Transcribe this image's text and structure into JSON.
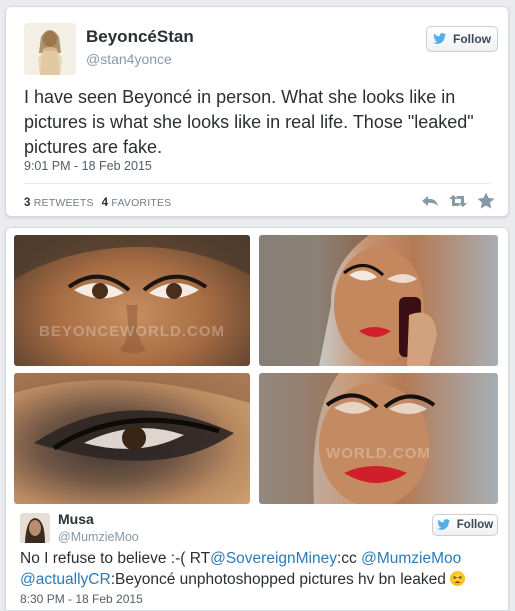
{
  "tweet1": {
    "display_name": "BeyoncéStan",
    "handle": "@stan4yonce",
    "follow_label": "Follow",
    "text": "I have seen Beyoncé in person. What she looks like in pictures is what she looks like in real life. Those \"leaked\" pictures are fake.",
    "timestamp": "9:01 PM - 18 Feb 2015",
    "retweets_count": "3",
    "retweets_label": "RETWEETS",
    "favorites_count": "4",
    "favorites_label": "FAVORITES",
    "icons": [
      "reply-icon",
      "retweet-icon",
      "favorite-icon",
      "twitter-bird-icon"
    ]
  },
  "tweet2": {
    "photos": [
      {
        "watermark": "BEYONCEWORLD.COM"
      },
      {
        "watermark": ""
      },
      {
        "watermark": ""
      },
      {
        "watermark": "WORLD.COM"
      }
    ],
    "display_name": "Musa",
    "handle": "@MumzieMoo",
    "follow_label": "Follow",
    "text_part1": "No I refuse to believe :-( RT",
    "mention1": "@SovereignMiney",
    "text_part2": ":cc ",
    "mention2": "@MumzieMoo",
    "mention3": "@actuallyCR",
    "text_part3": ":Beyoncé unphotoshopped pictures hv bn leaked ",
    "timestamp": "8:30 PM - 18 Feb 2015"
  },
  "colors": {
    "background": "#e9ebee",
    "link": "#2b7bb9",
    "twitter_blue": "#55acee",
    "text": "#292f33",
    "muted": "#8899a6"
  }
}
